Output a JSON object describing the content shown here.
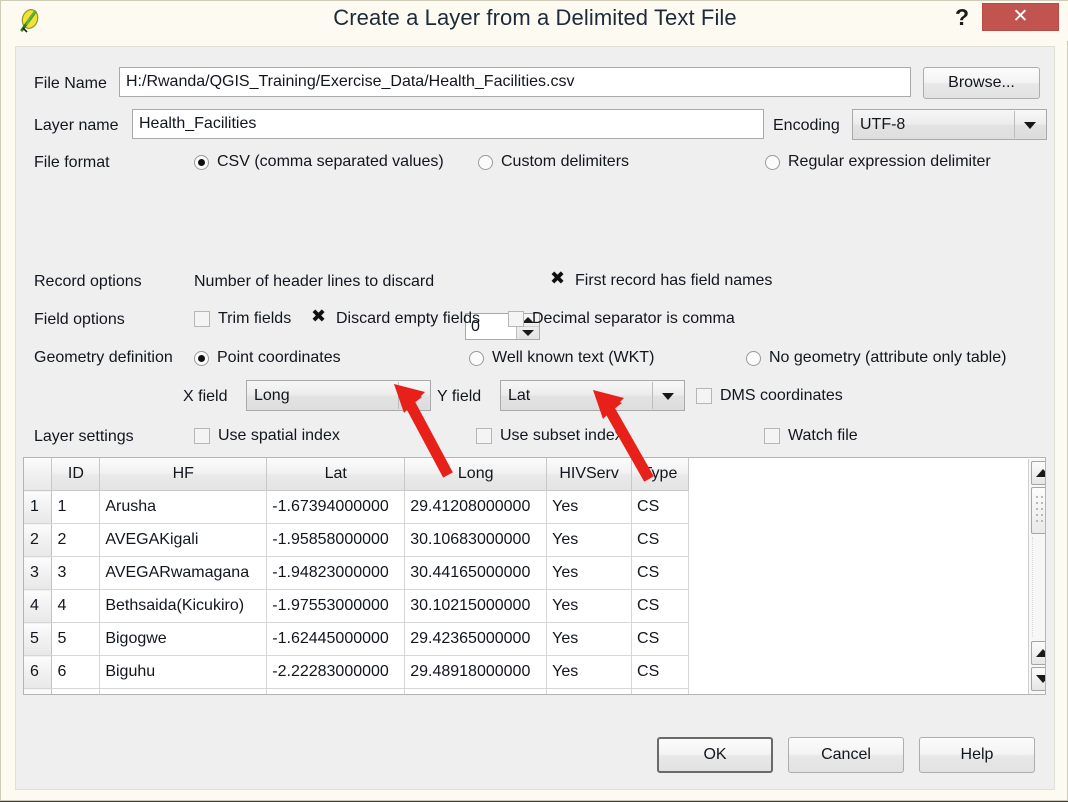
{
  "window": {
    "title": "Create a Layer from a Delimited Text File",
    "app_icon": "qgis-leaf-icon",
    "help_button": "?",
    "close_button": "✕"
  },
  "form": {
    "file_name_label": "File Name",
    "file_name_value": "H:/Rwanda/QGIS_Training/Exercise_Data/Health_Facilities.csv",
    "browse_label": "Browse...",
    "layer_name_label": "Layer name",
    "layer_name_value": "Health_Facilities",
    "encoding_label": "Encoding",
    "encoding_value": "UTF-8",
    "file_format_label": "File format",
    "file_format_options": [
      {
        "label": "CSV (comma separated values)",
        "selected": true
      },
      {
        "label": "Custom delimiters",
        "selected": false
      },
      {
        "label": "Regular expression delimiter",
        "selected": false
      }
    ],
    "record_options_label": "Record options",
    "header_lines_label": "Number of header lines to discard",
    "header_lines_value": "0",
    "first_record_label": "First record has field names",
    "first_record_checked": true,
    "field_options_label": "Field options",
    "trim_fields_label": "Trim fields",
    "trim_fields_checked": false,
    "discard_empty_label": "Discard empty fields",
    "discard_empty_checked": true,
    "decimal_comma_label": "Decimal separator is comma",
    "decimal_comma_checked": false,
    "geometry_definition_label": "Geometry definition",
    "geometry_options": [
      {
        "label": "Point coordinates",
        "selected": true
      },
      {
        "label": "Well known text (WKT)",
        "selected": false
      },
      {
        "label": "No geometry (attribute only table)",
        "selected": false
      }
    ],
    "x_field_label": "X field",
    "x_field_value": "Long",
    "y_field_label": "Y field",
    "y_field_value": "Lat",
    "dms_label": "DMS coordinates",
    "dms_checked": false,
    "layer_settings_label": "Layer settings",
    "spatial_index_label": "Use spatial index",
    "spatial_index_checked": false,
    "subset_index_label": "Use subset index",
    "subset_index_checked": false,
    "watch_file_label": "Watch file",
    "watch_file_checked": false
  },
  "preview_table": {
    "columns": [
      "",
      "ID",
      "HF",
      "Lat",
      "Long",
      "HIVServ",
      "Type"
    ],
    "rows": [
      {
        "n": "1",
        "cells": [
          "1",
          "Arusha",
          "-1.67394000000",
          "29.41208000000",
          "Yes",
          "CS"
        ]
      },
      {
        "n": "2",
        "cells": [
          "2",
          "AVEGAKigali",
          "-1.95858000000",
          "30.10683000000",
          "Yes",
          "CS"
        ]
      },
      {
        "n": "3",
        "cells": [
          "3",
          "AVEGARwamagana",
          "-1.94823000000",
          "30.44165000000",
          "Yes",
          "CS"
        ]
      },
      {
        "n": "4",
        "cells": [
          "4",
          "Bethsaida(Kicukiro)",
          "-1.97553000000",
          "30.10215000000",
          "Yes",
          "CS"
        ]
      },
      {
        "n": "5",
        "cells": [
          "5",
          "Bigogwe",
          "-1.62445000000",
          "29.42365000000",
          "Yes",
          "CS"
        ]
      },
      {
        "n": "6",
        "cells": [
          "6",
          "Biguhu",
          "-2.22283000000",
          "29.48918000000",
          "Yes",
          "CS"
        ]
      }
    ]
  },
  "footer": {
    "ok_label": "OK",
    "cancel_label": "Cancel",
    "help_label": "Help"
  },
  "annotations": {
    "arrow_color": "#e8201a",
    "arrows": [
      {
        "name": "arrow-to-x-field"
      },
      {
        "name": "arrow-to-y-field"
      }
    ]
  }
}
